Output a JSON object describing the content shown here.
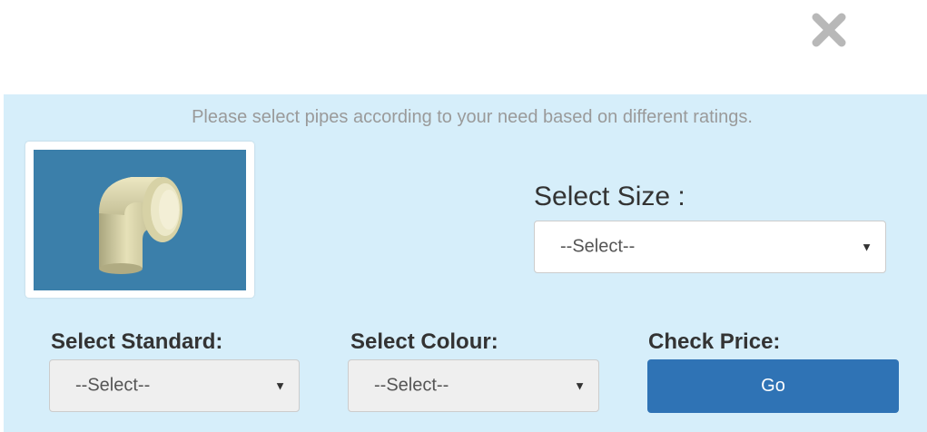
{
  "dialog": {
    "close_icon": "close-icon",
    "intro_text": "Please select pipes according to your need based on different ratings.",
    "product_image": "pipe-elbow-fitting",
    "size": {
      "label": "Select Size :",
      "value": "--Select--"
    },
    "standard": {
      "label": "Select Standard:",
      "value": "--Select--"
    },
    "colour": {
      "label": "Select Colour:",
      "value": "--Select--"
    },
    "price": {
      "label": "Check Price:",
      "button": "Go"
    }
  },
  "colors": {
    "panel_bg": "#d6eefa",
    "button_bg": "#2f73b5",
    "image_bg": "#3b7faa",
    "close_icon": "#b8b8b8"
  }
}
